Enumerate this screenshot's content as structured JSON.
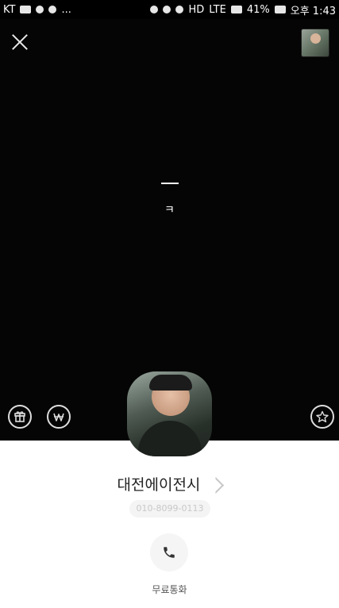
{
  "status_bar": {
    "carrier": "KT",
    "more": "...",
    "hd": "HD",
    "network": "LTE",
    "battery": "41%",
    "time": "오후 1:43"
  },
  "cover": {
    "status_char": "ㅋ"
  },
  "profile": {
    "name": "대전에이전시",
    "phone": "010-8099-0113"
  },
  "actions": {
    "free_call_label": "무료통화"
  },
  "icons": {
    "close": "close-icon",
    "gift": "gift-icon",
    "won": "won-icon",
    "star": "star-icon",
    "pencil": "pencil-icon",
    "phone": "phone-icon"
  },
  "colors": {
    "cover_background": "#050505",
    "page_background": "#ffffff"
  }
}
